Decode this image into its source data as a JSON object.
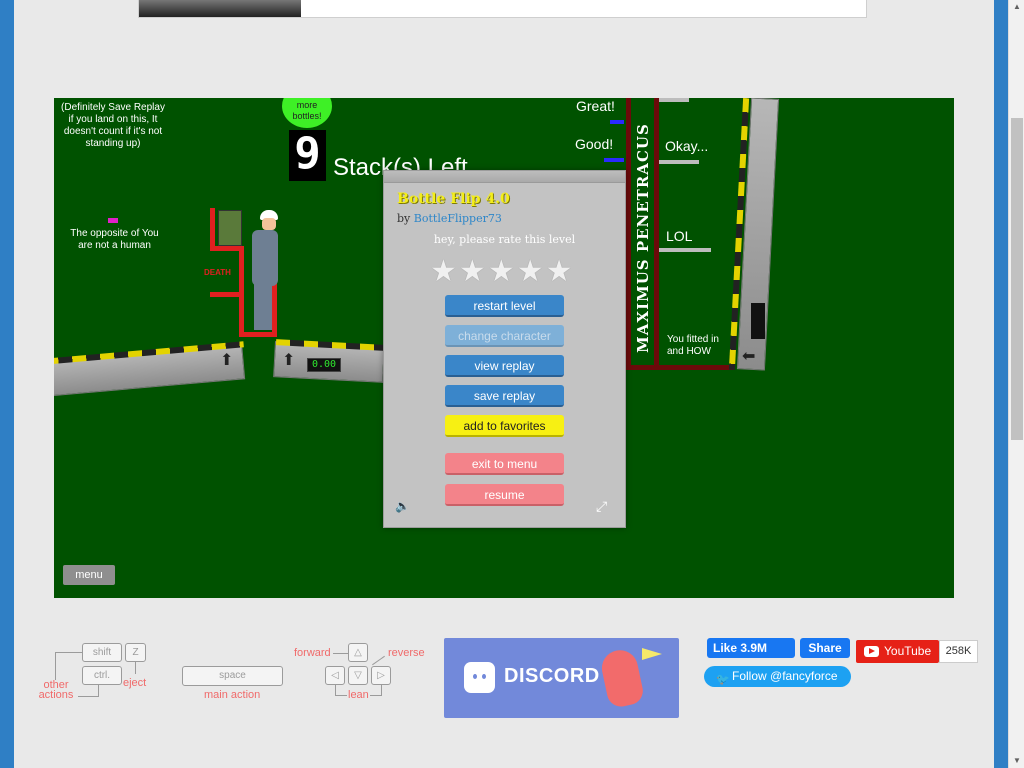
{
  "game": {
    "notes": {
      "replay": "(Definitely Save Replay if you land on this, It doesn't count if it's not standing up)",
      "more_bottles": "more bottles!",
      "opposite": "The opposite of You are not a human",
      "death": "DEATH",
      "great": "Great!",
      "good": "Good!",
      "okay": "Okay...",
      "lol": "LOL",
      "fitted": "You fitted in and HOW",
      "maximus": "MAXIMUS PENETRACUS",
      "stack_count": "9",
      "stacks_left": "Stack(s) Left",
      "counter": "0.00"
    },
    "menu_label": "menu",
    "modal": {
      "title": "Bottle Flip 4.0",
      "by": "by",
      "author": "BottleFlipper73",
      "rate_prompt": "hey, please rate this level",
      "star_glyph": "★",
      "buttons": {
        "restart": "restart level",
        "change_character": "change character",
        "view_replay": "view replay",
        "save_replay": "save replay",
        "favorites": "add to favorites",
        "exit": "exit to menu",
        "resume": "resume"
      }
    }
  },
  "controls": {
    "keys": {
      "shift": "shift",
      "z": "Z",
      "ctrl": "ctrl.",
      "space": "space"
    },
    "labels": {
      "other_actions": "other actions",
      "eject": "eject",
      "main_action": "main action",
      "forward": "forward",
      "reverse": "reverse",
      "lean": "lean"
    },
    "arrows": {
      "up": "△",
      "down": "▽",
      "left": "◁",
      "right": "▷"
    }
  },
  "social": {
    "discord": "DISCORD",
    "fb_like": "Like 3.9M",
    "fb_share": "Share",
    "youtube": "YouTube",
    "youtube_count": "258K",
    "twitter": "Follow @fancyforce"
  },
  "colors": {
    "game_bg": "#005200",
    "modal_title": "#f4ee1a",
    "button_blue": "#3a86c9",
    "button_yellow": "#f7f013",
    "button_pink": "#f3838a",
    "discord": "#7289da",
    "facebook": "#1877f2",
    "youtube": "#e62117",
    "twitter": "#1da1f2"
  }
}
